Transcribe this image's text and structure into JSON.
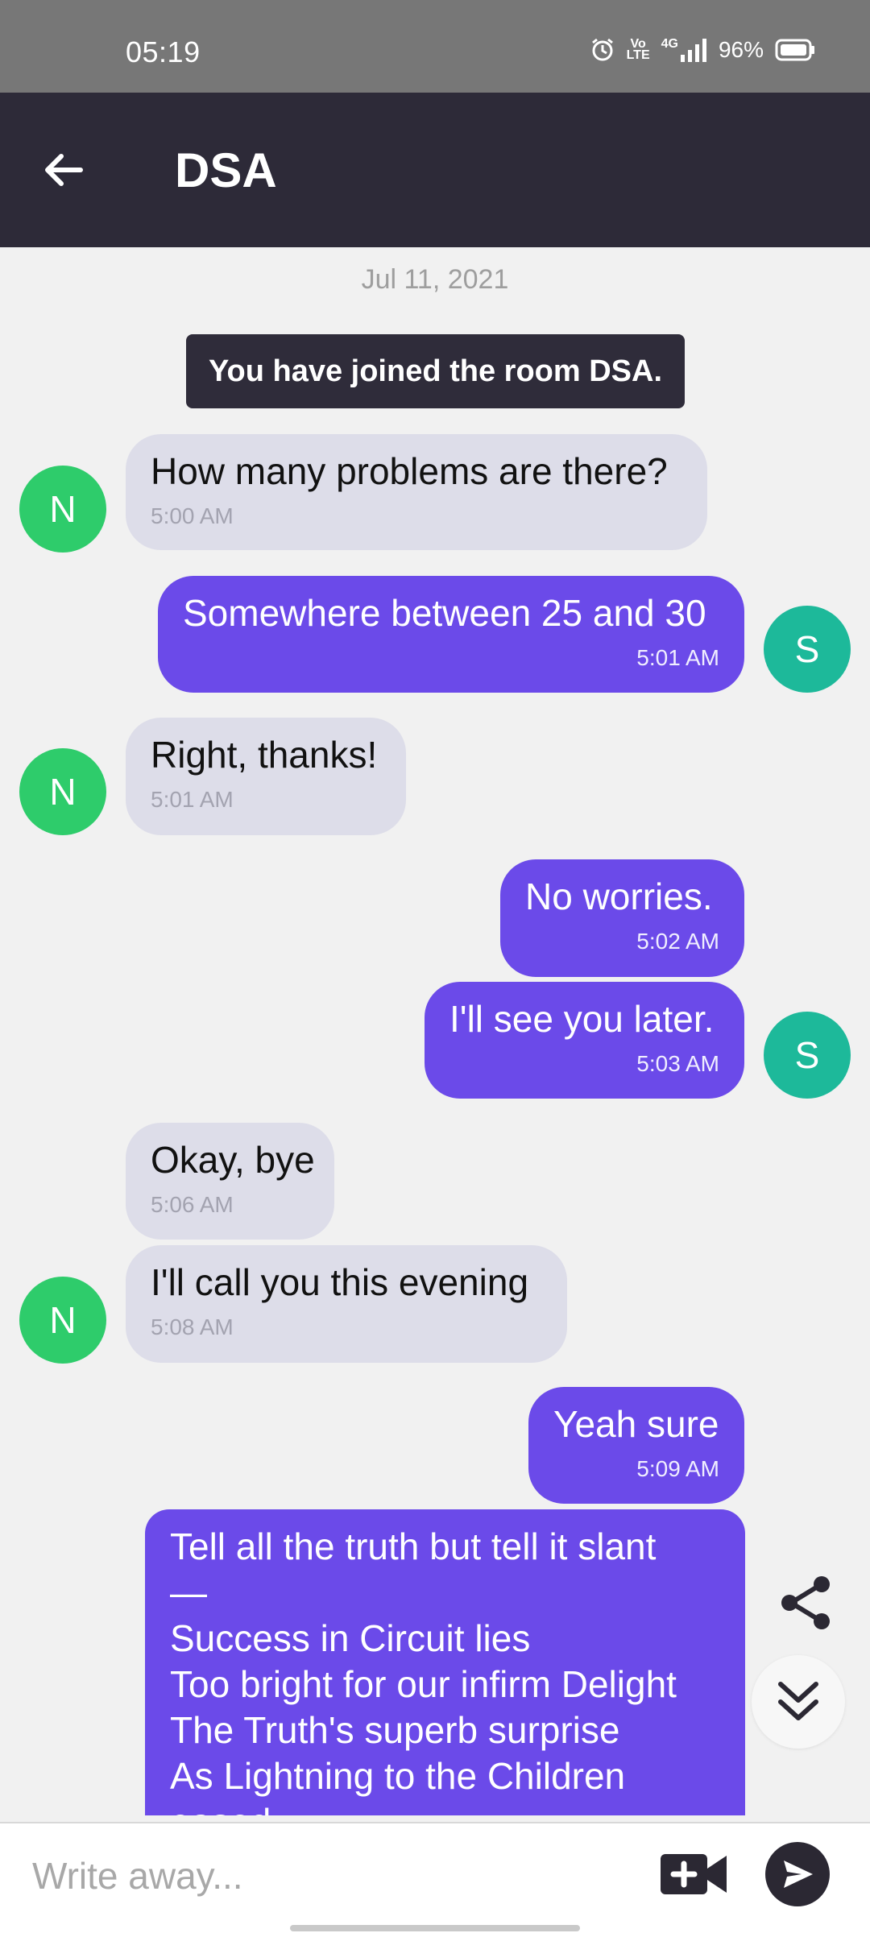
{
  "status_bar": {
    "time": "05:19",
    "volte_top": "Vo",
    "volte_bottom": "LTE",
    "network": "4G",
    "battery": "96%",
    "icons": [
      "alarm-icon",
      "volte-icon",
      "signal-icon",
      "battery-icon"
    ]
  },
  "header": {
    "title": "DSA",
    "back_icon": "arrow-left-icon"
  },
  "chat": {
    "date": "Jul 11, 2021",
    "system_message": "You have joined the room DSA.",
    "messages": [
      {
        "sender": "N",
        "direction": "in",
        "text": "How many problems are there?",
        "time": "5:00 AM"
      },
      {
        "sender": "S",
        "direction": "out",
        "text": "Somewhere between 25 and 30",
        "time": "5:01 AM"
      },
      {
        "sender": "N",
        "direction": "in",
        "text": "Right, thanks!",
        "time": "5:01 AM"
      },
      {
        "sender": "S",
        "direction": "out",
        "text": "No worries.",
        "time": "5:02 AM"
      },
      {
        "sender": "S",
        "direction": "out",
        "text": "I'll see you later.",
        "time": "5:03 AM"
      },
      {
        "sender": "N",
        "direction": "in",
        "text": "Okay, bye",
        "time": "5:06 AM"
      },
      {
        "sender": "N",
        "direction": "in",
        "text": "I'll call you this evening",
        "time": "5:08 AM"
      },
      {
        "sender": "S",
        "direction": "out",
        "text": "Yeah sure",
        "time": "5:09 AM"
      }
    ],
    "poem_lines": [
      "Tell all the truth but tell it slant",
      "—",
      "Success in Circuit lies",
      "Too bright for our infirm Delight",
      "The Truth's superb surprise",
      "As Lightning to the Children",
      "eased"
    ]
  },
  "floating": {
    "share_icon": "share-icon",
    "scroll_icon": "double-chevron-down-icon"
  },
  "composer": {
    "placeholder": "Write away...",
    "video_icon": "video-add-icon",
    "send_icon": "send-icon"
  },
  "colors": {
    "status_bar": "#777777",
    "app_bar": "#2d2a38",
    "outgoing_bubble": "#6b4ae9",
    "incoming_bubble": "#dddde9",
    "avatar_n": "#2ecc6b",
    "avatar_s": "#1db99a"
  }
}
